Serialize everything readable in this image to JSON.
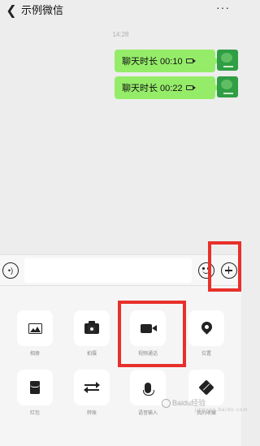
{
  "header": {
    "back_icon": "chevron-left-icon",
    "title": "示例微信",
    "more_label": "···"
  },
  "chat": {
    "timestamp": "14:28",
    "messages": [
      {
        "text": "聊天时长 00:10",
        "icon": "video-call-icon"
      },
      {
        "text": "聊天时长 00:22",
        "icon": "video-call-icon"
      }
    ]
  },
  "input_bar": {
    "voice_icon": "voice-icon",
    "text_value": "",
    "emoji_icon": "emoji-icon",
    "plus_icon": "plus-icon"
  },
  "panel": {
    "items": [
      {
        "label": "相册",
        "icon": "photo-icon"
      },
      {
        "label": "拍摄",
        "icon": "camera-icon"
      },
      {
        "label": "视频通话",
        "icon": "video-icon"
      },
      {
        "label": "位置",
        "icon": "location-pin-icon"
      },
      {
        "label": "红包",
        "icon": "red-packet-icon"
      },
      {
        "label": "转账",
        "icon": "transfer-icon"
      },
      {
        "label": "语音输入",
        "icon": "microphone-icon"
      },
      {
        "label": "我的收藏",
        "icon": "favorites-icon"
      }
    ]
  },
  "watermark": {
    "text": "Baidu经验",
    "sub": "jingyan.baidu.com"
  },
  "colors": {
    "bubble": "#95ec69",
    "background": "#ededed",
    "highlight": "#e8302a"
  }
}
